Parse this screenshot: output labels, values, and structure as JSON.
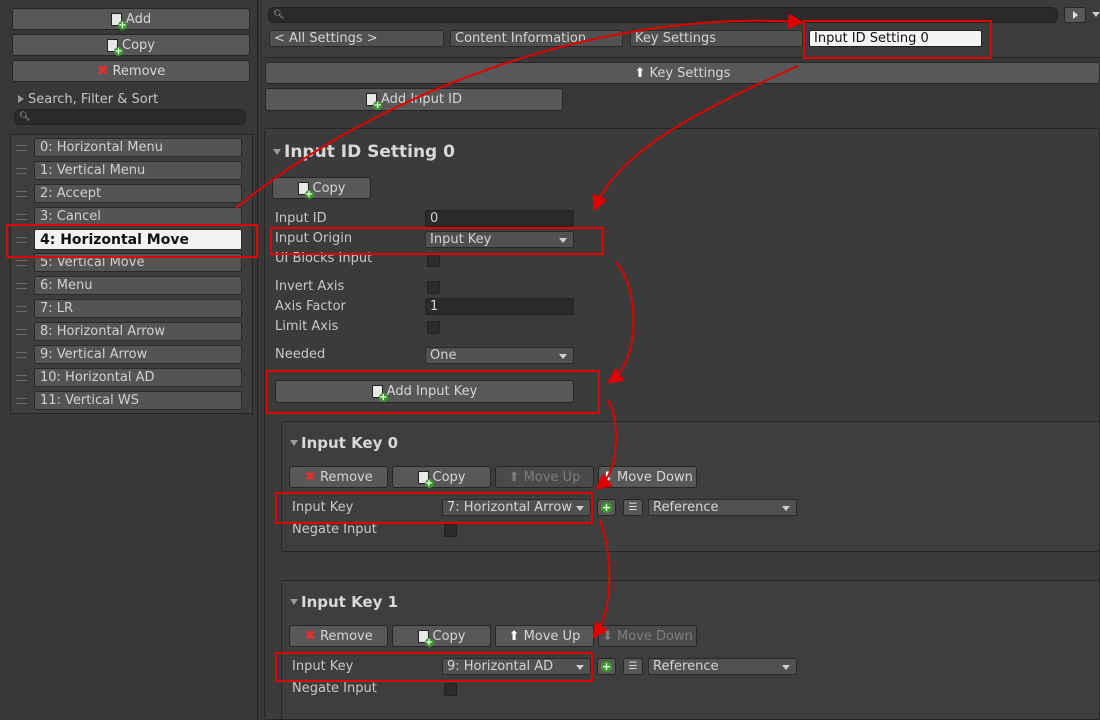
{
  "left": {
    "add_label": "Add",
    "copy_label": "Copy",
    "remove_label": "Remove",
    "filter_label": "Search, Filter & Sort",
    "search_value": "",
    "items": [
      "0: Horizontal Menu",
      "1: Vertical Menu",
      "2: Accept",
      "3: Cancel",
      "4: Horizontal Move",
      "5: Vertical Move",
      "6: Menu",
      "7: LR",
      "8: Horizontal Arrow",
      "9: Vertical Arrow",
      "10: Horizontal AD",
      "11: Vertical WS"
    ],
    "selected_index": 4
  },
  "top": {
    "search_value": "",
    "breadcrumbs": [
      "< All Settings >",
      "Content Information",
      "Key Settings"
    ],
    "name_value": "Input ID Setting 0"
  },
  "section": {
    "header_label": "Key Settings",
    "add_input_id_label": "Add Input ID",
    "title": "Input ID Setting 0",
    "copy_label": "Copy",
    "fields": {
      "input_id_label": "Input ID",
      "input_id_value": "0",
      "input_origin_label": "Input Origin",
      "input_origin_value": "Input Key",
      "ui_blocks_label": "UI Blocks Input",
      "invert_axis_label": "Invert Axis",
      "axis_factor_label": "Axis Factor",
      "axis_factor_value": "1",
      "limit_axis_label": "Limit Axis",
      "needed_label": "Needed",
      "needed_value": "One"
    },
    "add_input_key_label": "Add Input Key"
  },
  "input_keys": [
    {
      "title": "Input Key 0",
      "remove_label": "Remove",
      "copy_label": "Copy",
      "move_up_label": "Move Up",
      "move_down_label": "Move Down",
      "key_label": "Input Key",
      "key_value": "7: Horizontal Arrow",
      "mode_value": "Reference",
      "negate_label": "Negate Input"
    },
    {
      "title": "Input Key 1",
      "remove_label": "Remove",
      "copy_label": "Copy",
      "move_up_label": "Move Up",
      "move_down_label": "Move Down",
      "key_label": "Input Key",
      "key_value": "9: Horizontal AD",
      "mode_value": "Reference",
      "negate_label": "Negate Input"
    }
  ],
  "colors": {
    "annotation": "#e00000",
    "panel": "#383838",
    "selected": "#f2f2f2"
  }
}
